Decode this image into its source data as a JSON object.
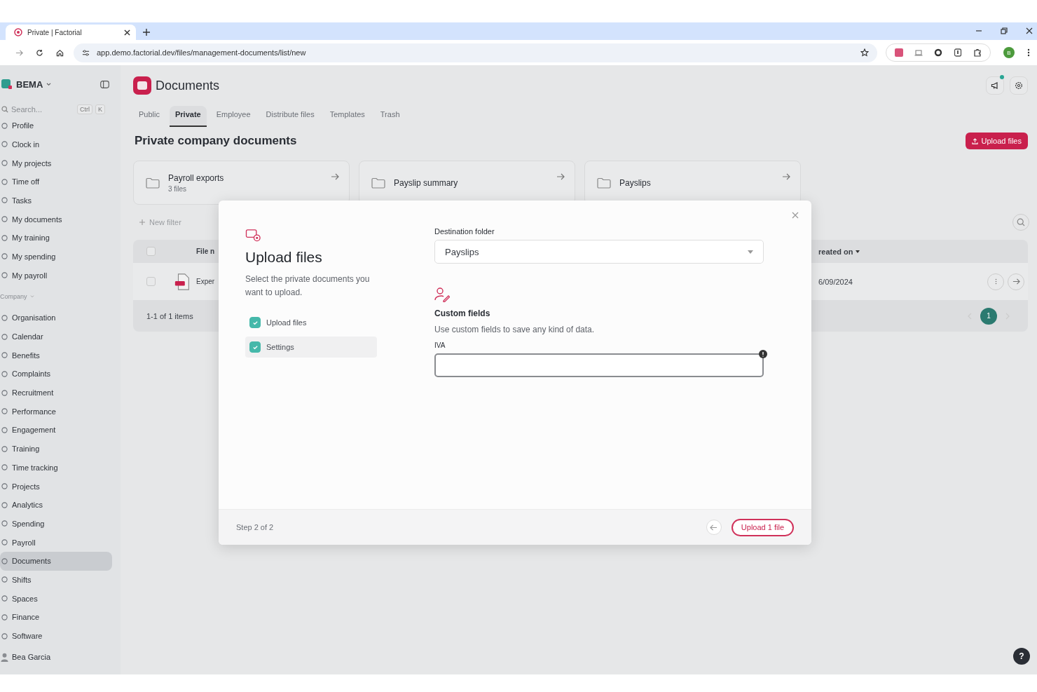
{
  "browser": {
    "tab_title": "Private | Factorial",
    "url": "app.demo.factorial.dev/files/management-documents/list/new",
    "profile_initial": "B"
  },
  "sidebar": {
    "company": "BEMA",
    "search": {
      "placeholder": "Search...",
      "keys": [
        "Ctrl",
        "K"
      ]
    },
    "items": [
      {
        "label": "Profile",
        "selected": false
      },
      {
        "label": "Clock in",
        "selected": false
      },
      {
        "label": "My projects",
        "selected": false
      },
      {
        "label": "Time off",
        "selected": false
      },
      {
        "label": "Tasks",
        "selected": false
      },
      {
        "label": "My documents",
        "selected": false
      },
      {
        "label": "My training",
        "selected": false
      },
      {
        "label": "My spending",
        "selected": false
      },
      {
        "label": "My payroll",
        "selected": false
      }
    ],
    "section": "Company",
    "company_items": [
      {
        "label": "Organisation",
        "selected": false
      },
      {
        "label": "Calendar",
        "selected": false
      },
      {
        "label": "Benefits",
        "selected": false
      },
      {
        "label": "Complaints",
        "selected": false
      },
      {
        "label": "Recruitment",
        "selected": false
      },
      {
        "label": "Performance",
        "selected": false
      },
      {
        "label": "Engagement",
        "selected": false
      },
      {
        "label": "Training",
        "selected": false
      },
      {
        "label": "Time tracking",
        "selected": false
      },
      {
        "label": "Projects",
        "selected": false
      },
      {
        "label": "Analytics",
        "selected": false
      },
      {
        "label": "Spending",
        "selected": false
      },
      {
        "label": "Payroll",
        "selected": false
      },
      {
        "label": "Documents",
        "selected": true
      },
      {
        "label": "Shifts",
        "selected": false
      },
      {
        "label": "Spaces",
        "selected": false
      },
      {
        "label": "Finance",
        "selected": false
      },
      {
        "label": "Software",
        "selected": false
      }
    ],
    "user": "Bea Garcia"
  },
  "page": {
    "title": "Documents",
    "tabs": [
      {
        "label": "Public",
        "selected": false
      },
      {
        "label": "Private",
        "selected": true
      },
      {
        "label": "Employee",
        "selected": false
      },
      {
        "label": "Distribute files",
        "selected": false
      },
      {
        "label": "Templates",
        "selected": false
      },
      {
        "label": "Trash",
        "selected": false
      }
    ],
    "heading": "Private company documents",
    "upload_button": "Upload files",
    "folders": [
      {
        "name": "Payroll exports",
        "count": "3 files"
      },
      {
        "name": "Payslip summary"
      },
      {
        "name": "Payslips"
      }
    ],
    "filter": "New filter",
    "table": {
      "all_checked": false,
      "columns": [
        "File n",
        "reated on"
      ],
      "rows": [
        {
          "name": "Exper",
          "created": "6/09/2024",
          "checked": false
        }
      ],
      "footer": "1-1 of 1 items",
      "pages": [
        {
          "label": "1",
          "selected": true
        }
      ]
    },
    "help_label": "?"
  },
  "modal": {
    "title": "Upload files",
    "description": "Select the private documents you want to upload.",
    "steps": [
      {
        "label": "Upload files",
        "checked": true,
        "selected": false
      },
      {
        "label": "Settings",
        "checked": true,
        "selected": true
      }
    ],
    "destination_label": "Destination folder",
    "destination_value": "Payslips",
    "custom_title": "Custom fields",
    "custom_description": "Use custom fields to save any kind of data.",
    "fields": [
      {
        "label": "IVA",
        "focused": true
      }
    ],
    "step_text": "Step 2 of 2",
    "submit": "Upload 1 file"
  }
}
